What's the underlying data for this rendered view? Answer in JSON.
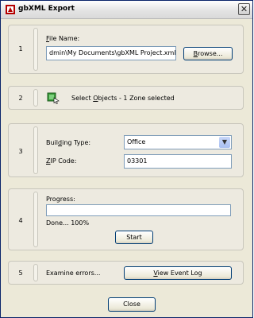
{
  "window": {
    "title": "gbXML Export",
    "close_glyph": "✕"
  },
  "icons": {
    "app": "gbxml-app-icon",
    "select": "select-objects-icon",
    "close": "close-icon",
    "dropdown": "chevron-down-icon"
  },
  "sections": [
    {
      "number": "1"
    },
    {
      "number": "2"
    },
    {
      "number": "3"
    },
    {
      "number": "4"
    },
    {
      "number": "5"
    }
  ],
  "file": {
    "label_u": "F",
    "label_rest": "ile Name:",
    "value": "dmin\\My Documents\\gbXML Project.xml",
    "browse_u": "B",
    "browse_rest": "rowse..."
  },
  "select": {
    "text_pre": "Select ",
    "text_u": "O",
    "text_post": "bjects - 1 Zone selected"
  },
  "building": {
    "type_pre": "Buil",
    "type_u": "d",
    "type_post": "ing Type:",
    "type_value": "Office",
    "zip_u": "Z",
    "zip_rest": "IP Code:",
    "zip_value": "03301"
  },
  "progress": {
    "label": "Progress:",
    "status": "Done... 100%",
    "percent": 100,
    "start_label": "Start"
  },
  "errors": {
    "label": "Examine errors...",
    "view_u": "V",
    "view_rest": "iew Event Log"
  },
  "footer": {
    "close_label": "Close"
  },
  "colors": {
    "title_border": "#0a246a",
    "panel": "#ece9d8",
    "field_border": "#7f9db9",
    "button_border": "#003c74"
  }
}
